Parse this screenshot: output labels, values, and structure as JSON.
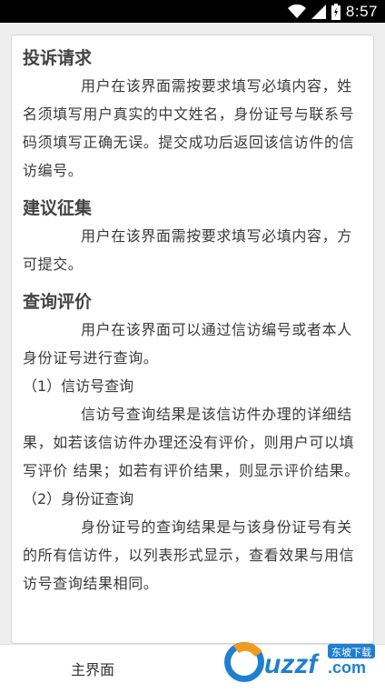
{
  "status_bar": {
    "time": "8:57",
    "icons": [
      "wifi-icon",
      "signal-icon",
      "battery-icon"
    ],
    "background": "#000000"
  },
  "content": {
    "sections": [
      {
        "title": "投诉请求",
        "lines": [
          "用户在该界面需按要求填写必填内容，姓名须填写用户真实的中文姓名，身份证号与联系号码须填写正确无误。提交成功后返回该信访件的信访编号。"
        ]
      },
      {
        "title": "建议征集",
        "lines": [
          "用户在该界面需按要求填写必填内容，方可提交。"
        ]
      },
      {
        "title": "查询评价",
        "intro": "用户在该界面可以通过信访编号或者本人身份证号进行查询。",
        "subsections": [
          {
            "heading": "（1）信访号查询",
            "text": "信访号查询结果是该信访件办理的详细结果，如若该信访件办理还没有评价，则用户可以填写评价 结果；如若有评价结果，则显示评价结果。"
          },
          {
            "heading": "（2）身份证查询",
            "text": "身份证号的查询结果是与该身份证号有关的所有信访件，以列表形式显示，查看效果与用信访号查询结果相同。"
          }
        ]
      }
    ]
  },
  "bottom_bar": {
    "main_label": "主界面"
  },
  "watermark": {
    "text": "uzzf.com",
    "tag": "东坡下载",
    "colors": {
      "orange": "#f39a1e",
      "blue": "#1f7fd1"
    }
  }
}
